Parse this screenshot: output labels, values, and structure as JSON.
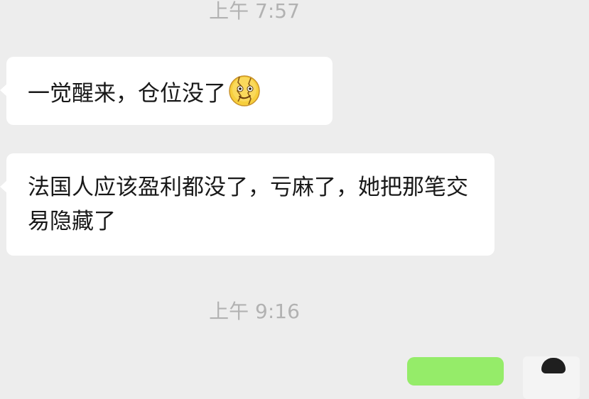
{
  "messages": [
    {
      "type": "time",
      "text": "上午 7:57"
    },
    {
      "type": "incoming",
      "text": "一觉醒来，仓位没了",
      "emoji": "cracked-face-emoji"
    },
    {
      "type": "incoming",
      "text": "法国人应该盈利都没了，亏麻了，她把那笔交易隐藏了"
    },
    {
      "type": "time",
      "text": "上午 9:16"
    },
    {
      "type": "outgoing",
      "text": ""
    }
  ],
  "colors": {
    "background": "#ededed",
    "incoming_bubble": "#ffffff",
    "outgoing_bubble": "#95ec69",
    "timestamp": "#b2b2b2",
    "text": "#191919"
  }
}
